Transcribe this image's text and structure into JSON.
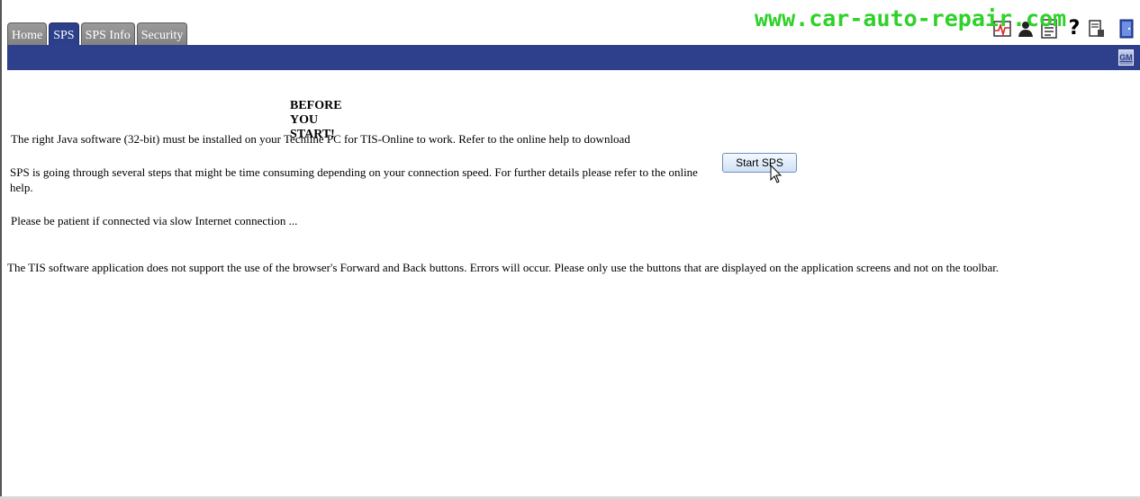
{
  "tabs": [
    {
      "label": "Home",
      "active": false
    },
    {
      "label": "SPS",
      "active": true
    },
    {
      "label": "SPS Info",
      "active": false
    },
    {
      "label": "Security",
      "active": false
    }
  ],
  "watermark": "www.car-auto-repair.com",
  "toolbar": {
    "icons": [
      "heartbeat-chart-icon",
      "user-icon",
      "document-icon",
      "help-icon",
      "print-icon",
      "exit-door-icon"
    ],
    "help_glyph": "?"
  },
  "brand": {
    "logo_text": "GM",
    "bar_color": "#2e3f8c"
  },
  "main": {
    "title": "BEFORE YOU START!",
    "paragraph_java": "The right Java software (32-bit) must be installed on your Techline PC for TIS-Online to work. Refer to the online help to download",
    "paragraph_steps": "SPS is going through several steps that might be time consuming depending on your connection speed. For further details please refer to the online help.",
    "paragraph_patience": "Please be patient if connected via slow Internet connection ...",
    "paragraph_browser": "The TIS software application does not support the use of the browser's Forward and Back buttons. Errors will occur. Please only use the buttons that are displayed on the application screens and not on the toolbar.",
    "start_button_label": "Start SPS"
  }
}
